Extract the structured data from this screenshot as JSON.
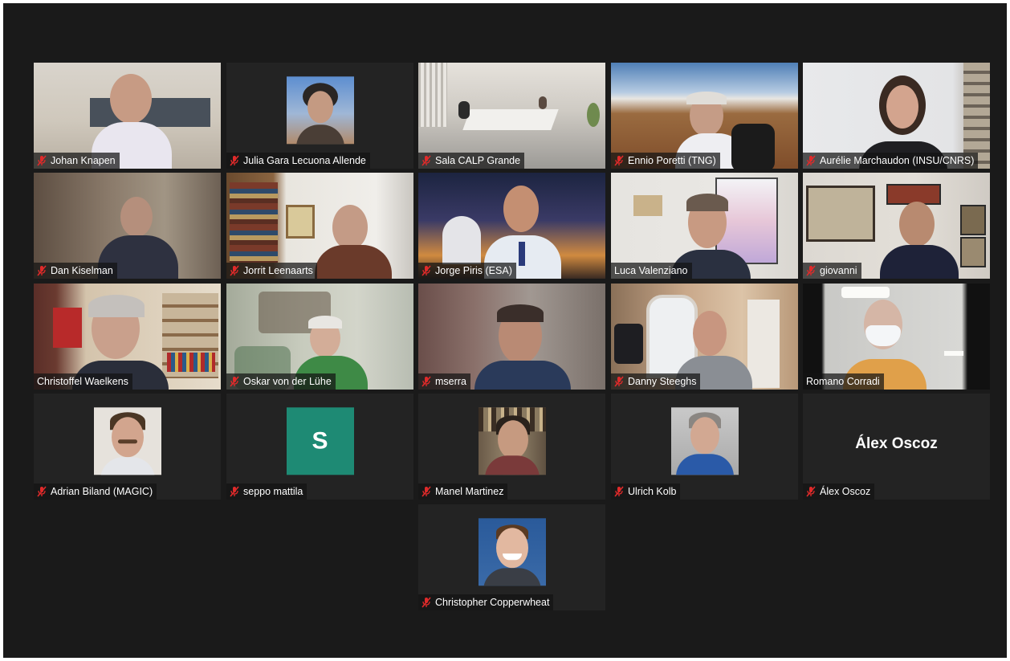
{
  "window": {
    "background": "#1a1a1a",
    "active_speaker_color": "#9bd33c",
    "muted_icon_color": "#e02a2a"
  },
  "participants": [
    {
      "name": "Johan Knapen",
      "muted": true,
      "type": "video"
    },
    {
      "name": "Julia Gara Lecuona Allende",
      "muted": true,
      "type": "photo"
    },
    {
      "name": "Sala CALP Grande",
      "muted": true,
      "type": "video"
    },
    {
      "name": "Ennio Poretti (TNG)",
      "muted": true,
      "type": "video"
    },
    {
      "name": "Aurélie Marchaudon (INSU/CNRS)",
      "muted": true,
      "type": "video"
    },
    {
      "name": "Dan Kiselman",
      "muted": true,
      "type": "video"
    },
    {
      "name": "Jorrit Leenaarts",
      "muted": true,
      "type": "video"
    },
    {
      "name": "Jorge Piris (ESA)",
      "muted": true,
      "type": "video"
    },
    {
      "name": "Luca Valenziano",
      "muted": false,
      "type": "video",
      "active": true
    },
    {
      "name": "giovanni",
      "muted": true,
      "type": "video"
    },
    {
      "name": "Christoffel Waelkens",
      "muted": false,
      "type": "video"
    },
    {
      "name": "Oskar von der Lühe",
      "muted": true,
      "type": "video"
    },
    {
      "name": "mserra",
      "muted": true,
      "type": "video"
    },
    {
      "name": "Danny Steeghs",
      "muted": true,
      "type": "video"
    },
    {
      "name": "Romano Corradi",
      "muted": false,
      "type": "video"
    },
    {
      "name": "Adrian Biland (MAGIC)",
      "muted": true,
      "type": "photo"
    },
    {
      "name": "seppo mattila",
      "muted": true,
      "type": "letter",
      "avatar_letter": "S",
      "avatar_color": "#1e8a74"
    },
    {
      "name": "Manel Martinez",
      "muted": true,
      "type": "photo"
    },
    {
      "name": "Ulrich Kolb",
      "muted": true,
      "type": "photo"
    },
    {
      "name": "Álex Oscoz",
      "muted": true,
      "type": "text",
      "display_name": "Álex Oscoz"
    },
    {
      "name": "Christopher Copperwheat",
      "muted": true,
      "type": "photo"
    }
  ]
}
